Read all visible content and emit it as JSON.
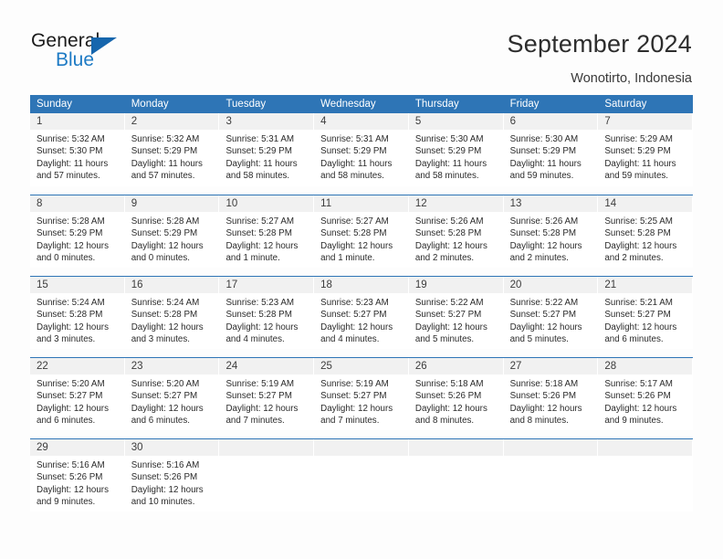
{
  "brand": {
    "word_one": "General",
    "word_two": "Blue",
    "triangle_icon": "triangle-icon",
    "brand_blue": "#1d7ac4",
    "triangle_blue": "#1666ad"
  },
  "header": {
    "title": "September 2024",
    "location": "Wonotirto, Indonesia"
  },
  "theme": {
    "header_blue": "#2e75b6",
    "daynum_band": "#f1f1f1",
    "page_background": "#fdfdfd",
    "text": "#2b2b2b"
  },
  "calendar": {
    "day_headers": [
      "Sunday",
      "Monday",
      "Tuesday",
      "Wednesday",
      "Thursday",
      "Friday",
      "Saturday"
    ],
    "labels": {
      "sunrise": "Sunrise:",
      "sunset": "Sunset:",
      "daylight": "Daylight:"
    },
    "weeks": [
      [
        {
          "day": "1",
          "sunrise": "Sunrise: 5:32 AM",
          "sunset": "Sunset: 5:30 PM",
          "daylight_line1": "Daylight: 11 hours",
          "daylight_line2": "and 57 minutes."
        },
        {
          "day": "2",
          "sunrise": "Sunrise: 5:32 AM",
          "sunset": "Sunset: 5:29 PM",
          "daylight_line1": "Daylight: 11 hours",
          "daylight_line2": "and 57 minutes."
        },
        {
          "day": "3",
          "sunrise": "Sunrise: 5:31 AM",
          "sunset": "Sunset: 5:29 PM",
          "daylight_line1": "Daylight: 11 hours",
          "daylight_line2": "and 58 minutes."
        },
        {
          "day": "4",
          "sunrise": "Sunrise: 5:31 AM",
          "sunset": "Sunset: 5:29 PM",
          "daylight_line1": "Daylight: 11 hours",
          "daylight_line2": "and 58 minutes."
        },
        {
          "day": "5",
          "sunrise": "Sunrise: 5:30 AM",
          "sunset": "Sunset: 5:29 PM",
          "daylight_line1": "Daylight: 11 hours",
          "daylight_line2": "and 58 minutes."
        },
        {
          "day": "6",
          "sunrise": "Sunrise: 5:30 AM",
          "sunset": "Sunset: 5:29 PM",
          "daylight_line1": "Daylight: 11 hours",
          "daylight_line2": "and 59 minutes."
        },
        {
          "day": "7",
          "sunrise": "Sunrise: 5:29 AM",
          "sunset": "Sunset: 5:29 PM",
          "daylight_line1": "Daylight: 11 hours",
          "daylight_line2": "and 59 minutes."
        }
      ],
      [
        {
          "day": "8",
          "sunrise": "Sunrise: 5:28 AM",
          "sunset": "Sunset: 5:29 PM",
          "daylight_line1": "Daylight: 12 hours",
          "daylight_line2": "and 0 minutes."
        },
        {
          "day": "9",
          "sunrise": "Sunrise: 5:28 AM",
          "sunset": "Sunset: 5:29 PM",
          "daylight_line1": "Daylight: 12 hours",
          "daylight_line2": "and 0 minutes."
        },
        {
          "day": "10",
          "sunrise": "Sunrise: 5:27 AM",
          "sunset": "Sunset: 5:28 PM",
          "daylight_line1": "Daylight: 12 hours",
          "daylight_line2": "and 1 minute."
        },
        {
          "day": "11",
          "sunrise": "Sunrise: 5:27 AM",
          "sunset": "Sunset: 5:28 PM",
          "daylight_line1": "Daylight: 12 hours",
          "daylight_line2": "and 1 minute."
        },
        {
          "day": "12",
          "sunrise": "Sunrise: 5:26 AM",
          "sunset": "Sunset: 5:28 PM",
          "daylight_line1": "Daylight: 12 hours",
          "daylight_line2": "and 2 minutes."
        },
        {
          "day": "13",
          "sunrise": "Sunrise: 5:26 AM",
          "sunset": "Sunset: 5:28 PM",
          "daylight_line1": "Daylight: 12 hours",
          "daylight_line2": "and 2 minutes."
        },
        {
          "day": "14",
          "sunrise": "Sunrise: 5:25 AM",
          "sunset": "Sunset: 5:28 PM",
          "daylight_line1": "Daylight: 12 hours",
          "daylight_line2": "and 2 minutes."
        }
      ],
      [
        {
          "day": "15",
          "sunrise": "Sunrise: 5:24 AM",
          "sunset": "Sunset: 5:28 PM",
          "daylight_line1": "Daylight: 12 hours",
          "daylight_line2": "and 3 minutes."
        },
        {
          "day": "16",
          "sunrise": "Sunrise: 5:24 AM",
          "sunset": "Sunset: 5:28 PM",
          "daylight_line1": "Daylight: 12 hours",
          "daylight_line2": "and 3 minutes."
        },
        {
          "day": "17",
          "sunrise": "Sunrise: 5:23 AM",
          "sunset": "Sunset: 5:28 PM",
          "daylight_line1": "Daylight: 12 hours",
          "daylight_line2": "and 4 minutes."
        },
        {
          "day": "18",
          "sunrise": "Sunrise: 5:23 AM",
          "sunset": "Sunset: 5:27 PM",
          "daylight_line1": "Daylight: 12 hours",
          "daylight_line2": "and 4 minutes."
        },
        {
          "day": "19",
          "sunrise": "Sunrise: 5:22 AM",
          "sunset": "Sunset: 5:27 PM",
          "daylight_line1": "Daylight: 12 hours",
          "daylight_line2": "and 5 minutes."
        },
        {
          "day": "20",
          "sunrise": "Sunrise: 5:22 AM",
          "sunset": "Sunset: 5:27 PM",
          "daylight_line1": "Daylight: 12 hours",
          "daylight_line2": "and 5 minutes."
        },
        {
          "day": "21",
          "sunrise": "Sunrise: 5:21 AM",
          "sunset": "Sunset: 5:27 PM",
          "daylight_line1": "Daylight: 12 hours",
          "daylight_line2": "and 6 minutes."
        }
      ],
      [
        {
          "day": "22",
          "sunrise": "Sunrise: 5:20 AM",
          "sunset": "Sunset: 5:27 PM",
          "daylight_line1": "Daylight: 12 hours",
          "daylight_line2": "and 6 minutes."
        },
        {
          "day": "23",
          "sunrise": "Sunrise: 5:20 AM",
          "sunset": "Sunset: 5:27 PM",
          "daylight_line1": "Daylight: 12 hours",
          "daylight_line2": "and 6 minutes."
        },
        {
          "day": "24",
          "sunrise": "Sunrise: 5:19 AM",
          "sunset": "Sunset: 5:27 PM",
          "daylight_line1": "Daylight: 12 hours",
          "daylight_line2": "and 7 minutes."
        },
        {
          "day": "25",
          "sunrise": "Sunrise: 5:19 AM",
          "sunset": "Sunset: 5:27 PM",
          "daylight_line1": "Daylight: 12 hours",
          "daylight_line2": "and 7 minutes."
        },
        {
          "day": "26",
          "sunrise": "Sunrise: 5:18 AM",
          "sunset": "Sunset: 5:26 PM",
          "daylight_line1": "Daylight: 12 hours",
          "daylight_line2": "and 8 minutes."
        },
        {
          "day": "27",
          "sunrise": "Sunrise: 5:18 AM",
          "sunset": "Sunset: 5:26 PM",
          "daylight_line1": "Daylight: 12 hours",
          "daylight_line2": "and 8 minutes."
        },
        {
          "day": "28",
          "sunrise": "Sunrise: 5:17 AM",
          "sunset": "Sunset: 5:26 PM",
          "daylight_line1": "Daylight: 12 hours",
          "daylight_line2": "and 9 minutes."
        }
      ],
      [
        {
          "day": "29",
          "sunrise": "Sunrise: 5:16 AM",
          "sunset": "Sunset: 5:26 PM",
          "daylight_line1": "Daylight: 12 hours",
          "daylight_line2": "and 9 minutes."
        },
        {
          "day": "30",
          "sunrise": "Sunrise: 5:16 AM",
          "sunset": "Sunset: 5:26 PM",
          "daylight_line1": "Daylight: 12 hours",
          "daylight_line2": "and 10 minutes."
        },
        {
          "day": "",
          "sunrise": "",
          "sunset": "",
          "daylight_line1": "",
          "daylight_line2": ""
        },
        {
          "day": "",
          "sunrise": "",
          "sunset": "",
          "daylight_line1": "",
          "daylight_line2": ""
        },
        {
          "day": "",
          "sunrise": "",
          "sunset": "",
          "daylight_line1": "",
          "daylight_line2": ""
        },
        {
          "day": "",
          "sunrise": "",
          "sunset": "",
          "daylight_line1": "",
          "daylight_line2": ""
        },
        {
          "day": "",
          "sunrise": "",
          "sunset": "",
          "daylight_line1": "",
          "daylight_line2": ""
        }
      ]
    ]
  }
}
